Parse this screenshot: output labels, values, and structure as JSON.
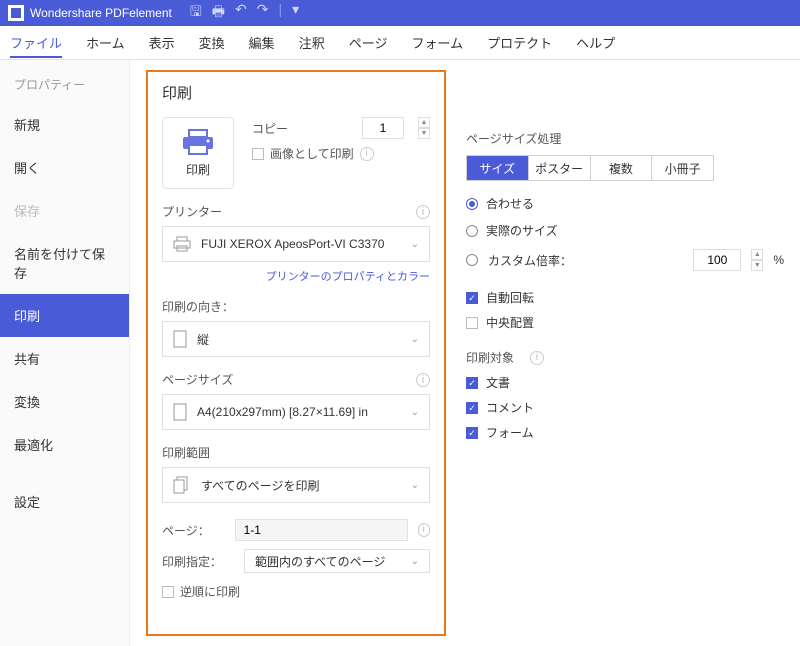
{
  "app": {
    "title": "Wondershare PDFelement"
  },
  "menubar": {
    "items": [
      "ファイル",
      "ホーム",
      "表示",
      "変換",
      "編集",
      "注釈",
      "ページ",
      "フォーム",
      "プロテクト",
      "ヘルプ"
    ],
    "active_index": 0
  },
  "sidebar": {
    "header": "プロパティー",
    "items": [
      {
        "label": "新規",
        "dim": false
      },
      {
        "label": "開く",
        "dim": false
      },
      {
        "label": "保存",
        "dim": true
      },
      {
        "label": "名前を付けて保存",
        "dim": false
      },
      {
        "label": "印刷",
        "active": true
      },
      {
        "label": "共有",
        "dim": false
      },
      {
        "label": "変換",
        "dim": false
      },
      {
        "label": "最適化",
        "dim": false
      },
      {
        "label": "設定",
        "dim": false
      }
    ]
  },
  "panel": {
    "title": "印刷",
    "print_button": "印刷",
    "copy_label": "コピー",
    "copy_value": "1",
    "image_print": "画像として印刷",
    "printer_label": "プリンター",
    "printer_value": "FUJI XEROX ApeosPort-VI C3370",
    "printer_link": "プリンターのプロパティとカラー",
    "orient_label": "印刷の向き：",
    "orient_value": "縦",
    "size_label": "ページサイズ",
    "size_value": "A4(210x297mm) [8.27×11.69] in",
    "range_label": "印刷範囲",
    "range_value": "すべてのページを印刷",
    "page_label": "ページ：",
    "page_value": "1-1",
    "spec_label": "印刷指定：",
    "spec_value": "範囲内のすべてのページ",
    "reverse_label": "逆順に印刷"
  },
  "right": {
    "size_handling": "ページサイズ処理",
    "tabs": [
      "サイズ",
      "ポスター",
      "複数",
      "小冊子"
    ],
    "tab_active": 0,
    "fit_options": {
      "fit": "合わせる",
      "actual": "実際のサイズ",
      "custom": "カスタム倍率："
    },
    "scale_value": "100",
    "percent": "%",
    "auto_rotate": "自動回転",
    "center": "中央配置",
    "target_label": "印刷対象",
    "targets": {
      "doc": "文書",
      "comment": "コメント",
      "form": "フォーム"
    }
  }
}
